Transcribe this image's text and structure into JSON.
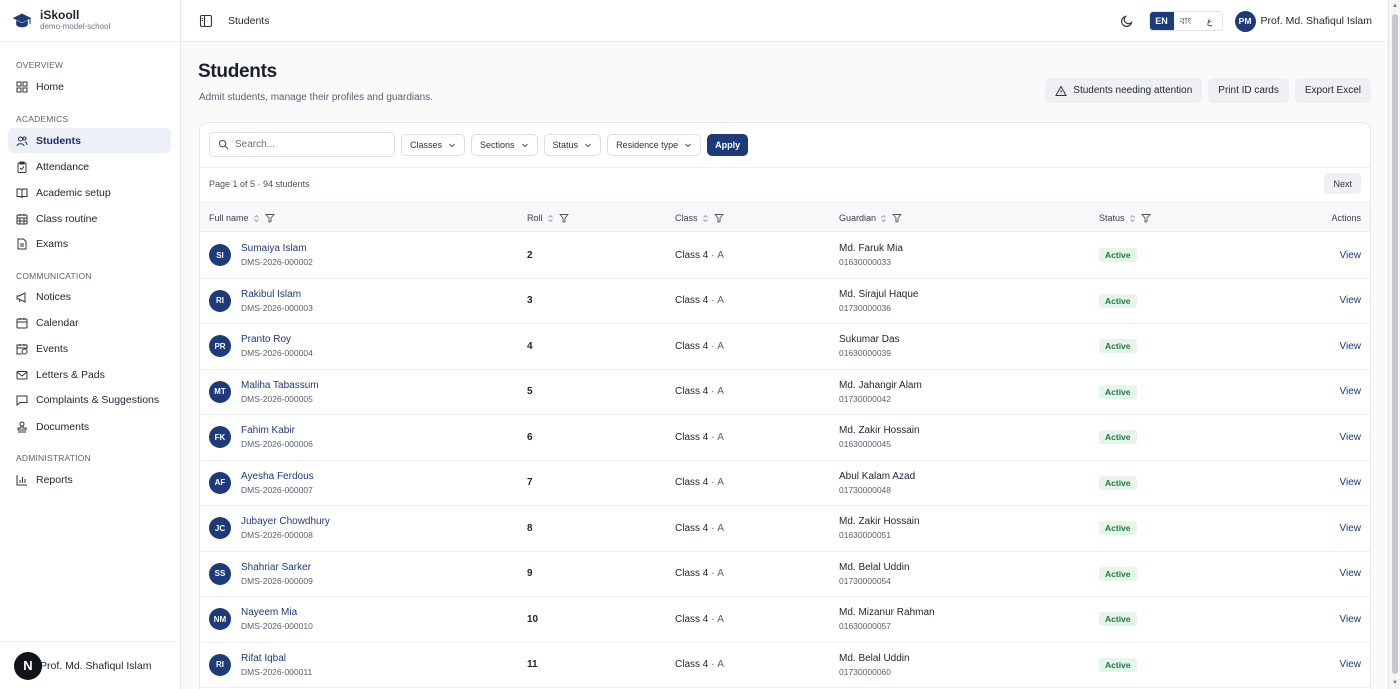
{
  "brand": {
    "name": "iSkooll",
    "subtitle": "demo-model-school"
  },
  "sidebar": {
    "sections": [
      {
        "label": "OVERVIEW",
        "items": [
          {
            "label": "Home",
            "icon": "grid-icon"
          }
        ]
      },
      {
        "label": "ACADEMICS",
        "items": [
          {
            "label": "Students",
            "icon": "users-icon",
            "active": true
          },
          {
            "label": "Attendance",
            "icon": "clipboard-check-icon"
          },
          {
            "label": "Academic setup",
            "icon": "book-open-icon"
          },
          {
            "label": "Class routine",
            "icon": "calendar-grid-icon"
          },
          {
            "label": "Exams",
            "icon": "file-text-icon"
          }
        ]
      },
      {
        "label": "COMMUNICATION",
        "items": [
          {
            "label": "Notices",
            "icon": "megaphone-icon"
          },
          {
            "label": "Calendar",
            "icon": "calendar-icon"
          },
          {
            "label": "Events",
            "icon": "calendar-clock-icon"
          },
          {
            "label": "Letters & Pads",
            "icon": "mail-icon"
          },
          {
            "label": "Complaints & Suggestions",
            "icon": "message-square-icon"
          },
          {
            "label": "Documents",
            "icon": "stamp-icon"
          }
        ]
      },
      {
        "label": "ADMINISTRATION",
        "items": [
          {
            "label": "Reports",
            "icon": "bar-chart-icon"
          }
        ]
      }
    ],
    "footer": {
      "avatar": "N",
      "name": "Prof. Md. Shafiqul Islam"
    }
  },
  "topbar": {
    "title": "Students",
    "languages": [
      "EN",
      "বাং",
      "ع"
    ],
    "active_language": "EN",
    "user": {
      "initials": "PM",
      "name": "Prof. Md. Shafiqul Islam"
    }
  },
  "page": {
    "title": "Students",
    "subtitle": "Admit students, manage their profiles and guardians.",
    "actions": {
      "attention": "Students needing attention",
      "print_id": "Print ID cards",
      "export": "Export Excel"
    }
  },
  "filters": {
    "search_placeholder": "Search...",
    "classes": "Classes",
    "sections": "Sections",
    "status": "Status",
    "residence": "Residence type",
    "apply": "Apply"
  },
  "pagination": {
    "info": "Page 1 of 5 · 94 students",
    "next": "Next"
  },
  "table": {
    "columns": {
      "name": "Full name",
      "roll": "Roll",
      "class": "Class",
      "guardian": "Guardian",
      "status": "Status",
      "actions": "Actions"
    },
    "rows": [
      {
        "initials": "SI",
        "name": "Sumaiya Islam",
        "id": "DMS-2026-000002",
        "roll": "2",
        "class": "Class 4",
        "section": "A",
        "guardian": "Md. Faruk Mia",
        "phone": "01630000033",
        "status": "Active",
        "action": "View"
      },
      {
        "initials": "RI",
        "name": "Rakibul Islam",
        "id": "DMS-2026-000003",
        "roll": "3",
        "class": "Class 4",
        "section": "A",
        "guardian": "Md. Sirajul Haque",
        "phone": "01730000036",
        "status": "Active",
        "action": "View"
      },
      {
        "initials": "PR",
        "name": "Pranto Roy",
        "id": "DMS-2026-000004",
        "roll": "4",
        "class": "Class 4",
        "section": "A",
        "guardian": "Sukumar Das",
        "phone": "01630000039",
        "status": "Active",
        "action": "View"
      },
      {
        "initials": "MT",
        "name": "Maliha Tabassum",
        "id": "DMS-2026-000005",
        "roll": "5",
        "class": "Class 4",
        "section": "A",
        "guardian": "Md. Jahangir Alam",
        "phone": "01730000042",
        "status": "Active",
        "action": "View"
      },
      {
        "initials": "FK",
        "name": "Fahim Kabir",
        "id": "DMS-2026-000006",
        "roll": "6",
        "class": "Class 4",
        "section": "A",
        "guardian": "Md. Zakir Hossain",
        "phone": "01630000045",
        "status": "Active",
        "action": "View"
      },
      {
        "initials": "AF",
        "name": "Ayesha Ferdous",
        "id": "DMS-2026-000007",
        "roll": "7",
        "class": "Class 4",
        "section": "A",
        "guardian": "Abul Kalam Azad",
        "phone": "01730000048",
        "status": "Active",
        "action": "View"
      },
      {
        "initials": "JC",
        "name": "Jubayer Chowdhury",
        "id": "DMS-2026-000008",
        "roll": "8",
        "class": "Class 4",
        "section": "A",
        "guardian": "Md. Zakir Hossain",
        "phone": "01630000051",
        "status": "Active",
        "action": "View"
      },
      {
        "initials": "SS",
        "name": "Shahriar Sarker",
        "id": "DMS-2026-000009",
        "roll": "9",
        "class": "Class 4",
        "section": "A",
        "guardian": "Md. Belal Uddin",
        "phone": "01730000054",
        "status": "Active",
        "action": "View"
      },
      {
        "initials": "NM",
        "name": "Nayeem Mia",
        "id": "DMS-2026-000010",
        "roll": "10",
        "class": "Class 4",
        "section": "A",
        "guardian": "Md. Mizanur Rahman",
        "phone": "01630000057",
        "status": "Active",
        "action": "View"
      },
      {
        "initials": "RI",
        "name": "Rifat Iqbal",
        "id": "DMS-2026-000011",
        "roll": "11",
        "class": "Class 4",
        "section": "A",
        "guardian": "Md. Belal Uddin",
        "phone": "01730000060",
        "status": "Active",
        "action": "View"
      }
    ]
  },
  "colors": {
    "primary": "#1d3a7a",
    "active_badge_bg": "#e6f5ea",
    "active_badge_text": "#1e7a3c"
  }
}
